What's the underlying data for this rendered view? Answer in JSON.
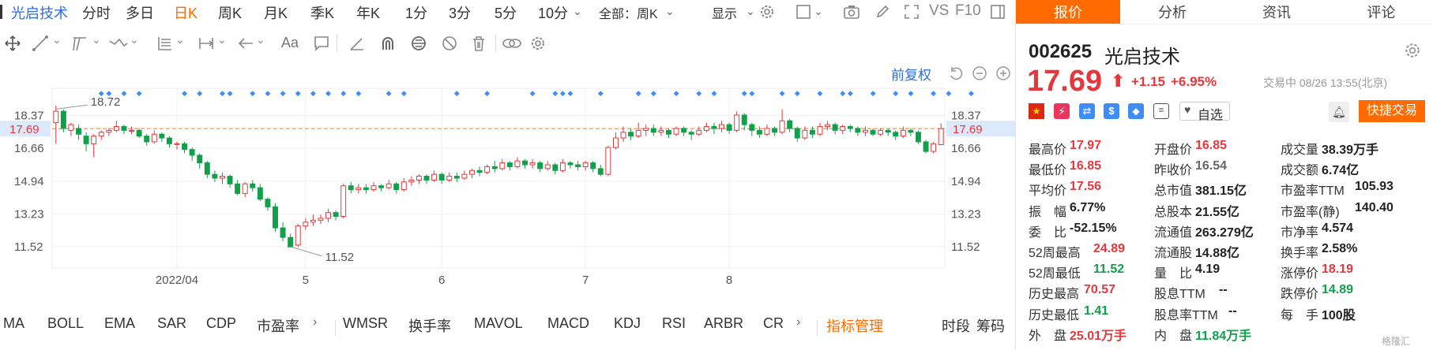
{
  "toolbar": {
    "stock_name": "光启技术",
    "periods": [
      "分时",
      "多日",
      "日K",
      "周K",
      "月K",
      "季K",
      "年K",
      "1分",
      "3分",
      "5分",
      "10分"
    ],
    "active_period": "日K",
    "range_select": "全部：周K",
    "display_label": "显示",
    "vs_label": "VS",
    "f10_label": "F10",
    "font_tool_label": "Aa",
    "adjust_label": "前复权"
  },
  "chart_data": {
    "type": "candlestick",
    "title": "",
    "x_ticks": [
      "2022/04",
      "5",
      "6",
      "7",
      "8"
    ],
    "y_ticks": [
      18.37,
      16.66,
      14.94,
      13.23,
      11.52
    ],
    "ylim": [
      10.4,
      19.8
    ],
    "current_price": 17.69,
    "high_label": "18.72",
    "low_label": "11.52",
    "grid": true,
    "candles": [
      [
        18.0,
        18.6,
        18.9,
        16.9
      ],
      [
        18.6,
        17.7,
        18.7,
        17.5
      ],
      [
        17.6,
        17.9,
        18.0,
        17.3
      ],
      [
        17.7,
        17.4,
        17.9,
        17.1
      ],
      [
        17.3,
        16.9,
        17.5,
        16.5
      ],
      [
        16.9,
        17.3,
        17.4,
        16.2
      ],
      [
        17.3,
        17.5,
        17.6,
        17.1
      ],
      [
        17.5,
        17.6,
        17.7,
        17.3
      ],
      [
        17.6,
        17.8,
        18.1,
        17.5
      ],
      [
        17.8,
        17.6,
        17.9,
        17.4
      ],
      [
        17.6,
        17.6,
        17.8,
        17.4
      ],
      [
        17.6,
        17.3,
        17.7,
        17.2
      ],
      [
        17.3,
        17.0,
        17.4,
        16.8
      ],
      [
        17.0,
        17.4,
        17.6,
        16.9
      ],
      [
        17.4,
        17.2,
        17.5,
        17.0
      ],
      [
        17.2,
        16.9,
        17.3,
        16.7
      ],
      [
        16.9,
        16.9,
        17.0,
        16.6
      ],
      [
        16.9,
        16.6,
        17.0,
        16.4
      ],
      [
        16.6,
        16.3,
        16.7,
        16.0
      ],
      [
        16.3,
        15.9,
        16.4,
        15.6
      ],
      [
        15.9,
        15.3,
        16.0,
        15.1
      ],
      [
        15.3,
        15.1,
        15.5,
        14.9
      ],
      [
        15.1,
        15.2,
        15.4,
        14.8
      ],
      [
        15.2,
        14.8,
        15.3,
        14.6
      ],
      [
        14.8,
        14.3,
        15.0,
        14.2
      ],
      [
        14.3,
        14.8,
        14.9,
        14.1
      ],
      [
        14.8,
        14.6,
        15.0,
        14.4
      ],
      [
        14.6,
        14.0,
        14.8,
        13.9
      ],
      [
        14.0,
        13.6,
        14.1,
        13.4
      ],
      [
        13.6,
        12.5,
        13.8,
        12.3
      ],
      [
        12.5,
        12.0,
        12.8,
        11.8
      ],
      [
        12.0,
        11.5,
        12.2,
        11.52
      ],
      [
        11.6,
        12.6,
        12.7,
        11.5
      ],
      [
        12.6,
        12.8,
        13.0,
        12.4
      ],
      [
        12.8,
        12.9,
        13.2,
        12.6
      ],
      [
        12.9,
        13.0,
        13.2,
        12.7
      ],
      [
        13.0,
        13.3,
        13.5,
        12.8
      ],
      [
        13.3,
        13.1,
        13.4,
        12.9
      ],
      [
        13.1,
        14.7,
        14.8,
        13.0
      ],
      [
        14.7,
        14.5,
        14.9,
        14.3
      ],
      [
        14.5,
        14.6,
        14.8,
        14.3
      ],
      [
        14.6,
        14.5,
        14.8,
        14.3
      ],
      [
        14.5,
        14.7,
        14.9,
        14.4
      ],
      [
        14.7,
        14.6,
        14.8,
        14.4
      ],
      [
        14.6,
        14.8,
        15.0,
        14.5
      ],
      [
        14.8,
        14.5,
        14.9,
        14.3
      ],
      [
        14.5,
        14.9,
        15.1,
        14.4
      ],
      [
        14.9,
        15.0,
        15.2,
        14.7
      ],
      [
        15.0,
        15.2,
        15.3,
        14.8
      ],
      [
        15.2,
        15.0,
        15.3,
        14.8
      ],
      [
        15.0,
        15.3,
        15.5,
        14.9
      ],
      [
        15.3,
        15.0,
        15.4,
        14.8
      ],
      [
        15.0,
        15.2,
        15.4,
        14.9
      ],
      [
        15.2,
        15.1,
        15.4,
        14.9
      ],
      [
        15.1,
        15.3,
        15.5,
        15.0
      ],
      [
        15.3,
        15.5,
        15.6,
        15.1
      ],
      [
        15.5,
        15.4,
        15.7,
        15.2
      ],
      [
        15.4,
        15.7,
        15.8,
        15.3
      ],
      [
        15.7,
        15.6,
        16.0,
        15.4
      ],
      [
        15.6,
        15.9,
        16.1,
        15.5
      ],
      [
        15.9,
        15.7,
        16.0,
        15.5
      ],
      [
        15.7,
        16.0,
        16.2,
        15.6
      ],
      [
        16.0,
        15.8,
        16.1,
        15.6
      ],
      [
        15.8,
        15.9,
        16.1,
        15.6
      ],
      [
        15.9,
        15.6,
        16.0,
        15.4
      ],
      [
        15.6,
        15.8,
        16.0,
        15.5
      ],
      [
        15.8,
        15.5,
        15.9,
        15.3
      ],
      [
        15.5,
        15.9,
        16.1,
        15.4
      ],
      [
        15.9,
        15.8,
        16.0,
        15.6
      ],
      [
        15.8,
        15.7,
        16.0,
        15.5
      ],
      [
        15.7,
        15.9,
        16.0,
        15.5
      ],
      [
        15.9,
        15.6,
        16.0,
        15.4
      ],
      [
        15.6,
        15.3,
        15.8,
        15.2
      ],
      [
        15.3,
        16.7,
        16.8,
        15.2
      ],
      [
        16.7,
        17.2,
        17.5,
        16.6
      ],
      [
        17.2,
        17.5,
        17.8,
        17.0
      ],
      [
        17.5,
        17.3,
        17.7,
        17.1
      ],
      [
        17.3,
        17.6,
        18.0,
        17.2
      ],
      [
        17.6,
        17.7,
        17.9,
        17.3
      ],
      [
        17.7,
        17.5,
        17.9,
        17.3
      ],
      [
        17.5,
        17.6,
        17.8,
        17.3
      ],
      [
        17.6,
        17.4,
        17.7,
        17.2
      ],
      [
        17.4,
        17.7,
        17.8,
        17.3
      ],
      [
        17.7,
        17.5,
        17.8,
        17.3
      ],
      [
        17.5,
        17.4,
        17.6,
        17.1
      ],
      [
        17.4,
        17.6,
        17.8,
        17.3
      ],
      [
        17.6,
        17.8,
        18.0,
        17.5
      ],
      [
        17.8,
        17.7,
        18.0,
        17.4
      ],
      [
        17.7,
        17.9,
        18.1,
        17.5
      ],
      [
        17.9,
        17.6,
        18.0,
        17.4
      ],
      [
        17.6,
        18.4,
        18.6,
        17.5
      ],
      [
        18.4,
        17.9,
        18.5,
        17.6
      ],
      [
        17.9,
        17.6,
        18.0,
        17.3
      ],
      [
        17.6,
        17.4,
        17.8,
        17.2
      ],
      [
        17.4,
        17.7,
        17.9,
        17.3
      ],
      [
        17.7,
        17.5,
        17.8,
        17.3
      ],
      [
        17.5,
        18.1,
        18.7,
        17.4
      ],
      [
        18.1,
        17.7,
        18.2,
        17.5
      ],
      [
        17.7,
        17.2,
        17.8,
        17.0
      ],
      [
        17.2,
        17.6,
        17.8,
        17.1
      ],
      [
        17.6,
        17.4,
        17.8,
        17.2
      ],
      [
        17.4,
        17.8,
        18.0,
        17.3
      ],
      [
        17.8,
        17.9,
        18.1,
        17.6
      ],
      [
        17.9,
        17.6,
        18.0,
        17.4
      ],
      [
        17.6,
        17.8,
        17.9,
        17.4
      ],
      [
        17.8,
        17.7,
        17.9,
        17.5
      ],
      [
        17.7,
        17.5,
        17.8,
        17.3
      ],
      [
        17.5,
        17.6,
        17.8,
        17.3
      ],
      [
        17.6,
        17.4,
        17.7,
        17.3
      ],
      [
        17.4,
        17.6,
        17.7,
        17.3
      ],
      [
        17.6,
        17.5,
        17.7,
        17.3
      ],
      [
        17.5,
        17.3,
        17.6,
        17.1
      ],
      [
        17.3,
        17.6,
        17.8,
        17.2
      ],
      [
        17.6,
        17.5,
        17.7,
        17.3
      ],
      [
        17.5,
        17.0,
        17.6,
        16.9
      ],
      [
        17.0,
        16.5,
        17.1,
        16.4
      ],
      [
        16.5,
        16.9,
        17.0,
        16.4
      ],
      [
        16.85,
        17.69,
        17.97,
        16.85
      ]
    ],
    "markers": [
      6,
      7,
      9,
      11,
      17,
      19,
      22,
      23,
      26,
      28,
      30,
      32,
      34,
      36,
      38,
      40,
      44,
      46,
      53,
      57,
      63,
      66,
      67,
      68,
      72,
      77,
      79,
      82,
      85,
      87,
      91,
      92,
      96,
      98,
      101,
      104,
      105,
      108,
      111,
      113,
      116,
      118,
      121
    ]
  },
  "bottom_bar": {
    "indicators": [
      "MA",
      "BOLL",
      "EMA",
      "SAR",
      "CDP",
      "市盈率",
      "WMSR",
      "换手率",
      "MAVOL",
      "MACD",
      "KDJ",
      "RSI",
      "ARBR",
      "CR"
    ],
    "manage_label": "指标管理",
    "right_labels": [
      "时段",
      "筹码"
    ]
  },
  "panel": {
    "tabs": [
      "报价",
      "分析",
      "资讯",
      "评论"
    ],
    "active_tab": "报价",
    "code": "002625",
    "name": "光启技术",
    "price": "17.69",
    "change": "+1.15",
    "change_pct": "+6.95%",
    "trade_status": "交易中 08/26 13:55(北京)",
    "watchlist_label": "自选",
    "quick_trade_label": "快捷交易",
    "stats": [
      {
        "k": "最高价",
        "v": "17.97",
        "c": "red"
      },
      {
        "k": "开盘价",
        "v": "16.85",
        "c": "red"
      },
      {
        "k": "成交量",
        "v": "38.39万手",
        "c": "black"
      },
      {
        "k": "最低价",
        "v": "16.85",
        "c": "red"
      },
      {
        "k": "昨收价",
        "v": "16.54",
        "c": "gray"
      },
      {
        "k": "成交额",
        "v": "6.74亿",
        "c": "black"
      },
      {
        "k": "平均价",
        "v": "17.56",
        "c": "red"
      },
      {
        "k": "总市值",
        "v": "381.15亿",
        "c": "black"
      },
      {
        "k": "市盈率TTM",
        "v": "105.93",
        "c": "black"
      },
      {
        "k": "振　幅",
        "v": "6.77%",
        "c": "black"
      },
      {
        "k": "总股本",
        "v": "21.55亿",
        "c": "black"
      },
      {
        "k": "市盈率(静)",
        "v": "140.40",
        "c": "black"
      },
      {
        "k": "委　比",
        "v": "-52.15%",
        "c": "black"
      },
      {
        "k": "流通值",
        "v": "263.279亿",
        "c": "black"
      },
      {
        "k": "市净率",
        "v": "4.574",
        "c": "black"
      },
      {
        "k": "52周最高",
        "v": "24.89",
        "c": "red"
      },
      {
        "k": "流通股",
        "v": "14.88亿",
        "c": "black"
      },
      {
        "k": "换手率",
        "v": "2.58%",
        "c": "black"
      },
      {
        "k": "52周最低",
        "v": "11.52",
        "c": "green"
      },
      {
        "k": "量　比",
        "v": "4.19",
        "c": "black"
      },
      {
        "k": "涨停价",
        "v": "18.19",
        "c": "red"
      },
      {
        "k": "历史最高",
        "v": "70.57",
        "c": "red"
      },
      {
        "k": "股息TTM",
        "v": "--",
        "c": "black"
      },
      {
        "k": "跌停价",
        "v": "14.89",
        "c": "green"
      },
      {
        "k": "历史最低",
        "v": "1.41",
        "c": "green"
      },
      {
        "k": "股息率TTM",
        "v": "--",
        "c": "black"
      },
      {
        "k": "每　手",
        "v": "100股",
        "c": "black"
      },
      {
        "k": "外　盘",
        "v": "25.01万手",
        "c": "red"
      },
      {
        "k": "内　盘",
        "v": "11.84万手",
        "c": "green"
      }
    ],
    "watermark": "格隆汇"
  }
}
